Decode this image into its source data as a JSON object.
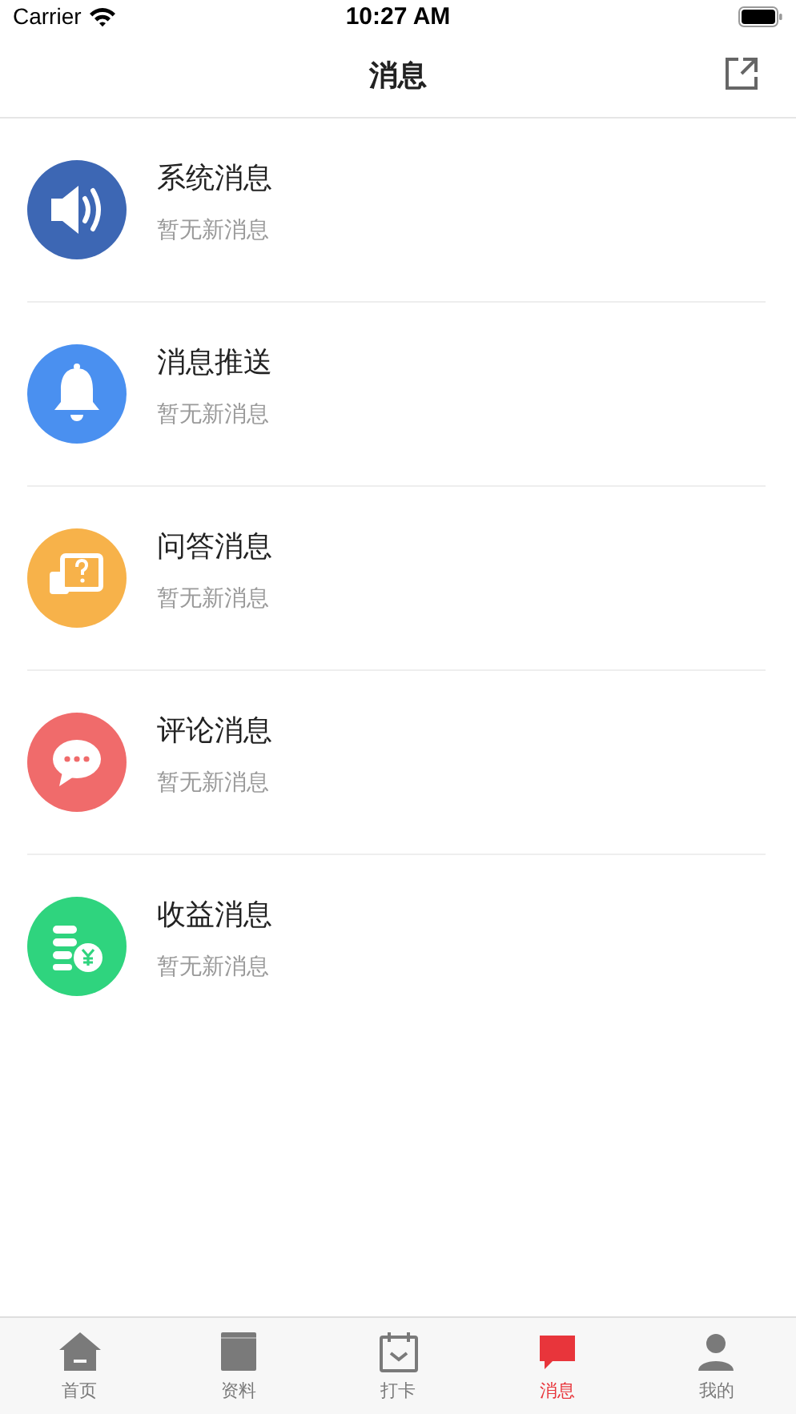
{
  "status_bar": {
    "carrier": "Carrier",
    "time": "10:27 AM"
  },
  "nav": {
    "title": "消息"
  },
  "messages": [
    {
      "kind": "speaker",
      "title": "系统消息",
      "subtitle": "暂无新消息",
      "color": "#3d67b4"
    },
    {
      "kind": "bell",
      "title": "消息推送",
      "subtitle": "暂无新消息",
      "color": "#4a90f0"
    },
    {
      "kind": "qa",
      "title": "问答消息",
      "subtitle": "暂无新消息",
      "color": "#f7b24a"
    },
    {
      "kind": "comment",
      "title": "评论消息",
      "subtitle": "暂无新消息",
      "color": "#f06b6b"
    },
    {
      "kind": "coins",
      "title": "收益消息",
      "subtitle": "暂无新消息",
      "color": "#2fd47e"
    }
  ],
  "tabs": [
    {
      "kind": "home",
      "label": "首页",
      "selected": false
    },
    {
      "kind": "book",
      "label": "资料",
      "selected": false
    },
    {
      "kind": "calendar",
      "label": "打卡",
      "selected": false
    },
    {
      "kind": "chat",
      "label": "消息",
      "selected": true
    },
    {
      "kind": "person",
      "label": "我的",
      "selected": false
    }
  ]
}
